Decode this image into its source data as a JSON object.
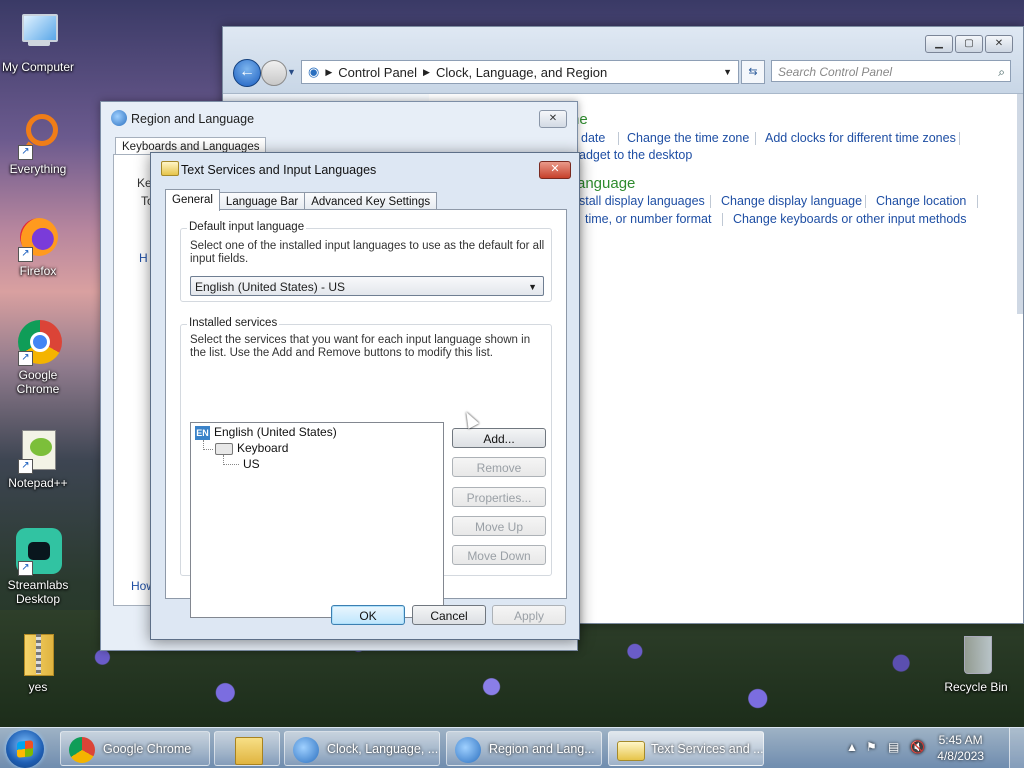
{
  "desktop": {
    "icons": [
      {
        "label": "My Computer"
      },
      {
        "label": "Everything"
      },
      {
        "label": "Firefox"
      },
      {
        "label": "Google Chrome"
      },
      {
        "label": "Notepad++"
      },
      {
        "label": "Streamlabs Desktop"
      },
      {
        "label": "yes"
      },
      {
        "label": "Recycle Bin"
      }
    ]
  },
  "control_panel": {
    "breadcrumb": [
      "Control Panel",
      "Clock, Language, and Region"
    ],
    "search_placeholder": "Search Control Panel",
    "cat1_title_partial": "ne",
    "cat1_links": [
      "date",
      "Change the time zone",
      "Add clocks for different time zones"
    ],
    "cat1_link2": "adget to the desktop",
    "cat2_title_partial": "anguage",
    "cat2_links": [
      "stall display languages",
      "Change display language",
      "Change location"
    ],
    "cat2_links_b": [
      "time, or number format",
      "Change keyboards or other input methods"
    ]
  },
  "region_language": {
    "title": "Region and Language",
    "tab": "Keyboards and Languages",
    "partial1": "Ke",
    "partial2": "To",
    "partial_link1": "H",
    "partial_link2": "How"
  },
  "text_services": {
    "title": "Text Services and Input Languages",
    "tabs": [
      "General",
      "Language Bar",
      "Advanced Key Settings"
    ],
    "default_group_label": "Default input language",
    "default_desc": "Select one of the installed input languages to use as the default for all input fields.",
    "default_value": "English (United States) - US",
    "installed_group_label": "Installed services",
    "installed_desc": "Select the services that you want for each input language shown in the list. Use the Add and Remove buttons to modify this list.",
    "tree": {
      "lang_badge": "EN",
      "language": "English (United States)",
      "category": "Keyboard",
      "item": "US"
    },
    "side_buttons": [
      "Add...",
      "Remove",
      "Properties...",
      "Move Up",
      "Move Down"
    ],
    "ok": "OK",
    "cancel": "Cancel",
    "apply": "Apply"
  },
  "taskbar": {
    "items": [
      "Google Chrome",
      "Clock, Language, ...",
      "Region and Lang...",
      "Text Services and ..."
    ],
    "time": "5:45 AM",
    "date": "4/8/2023"
  }
}
